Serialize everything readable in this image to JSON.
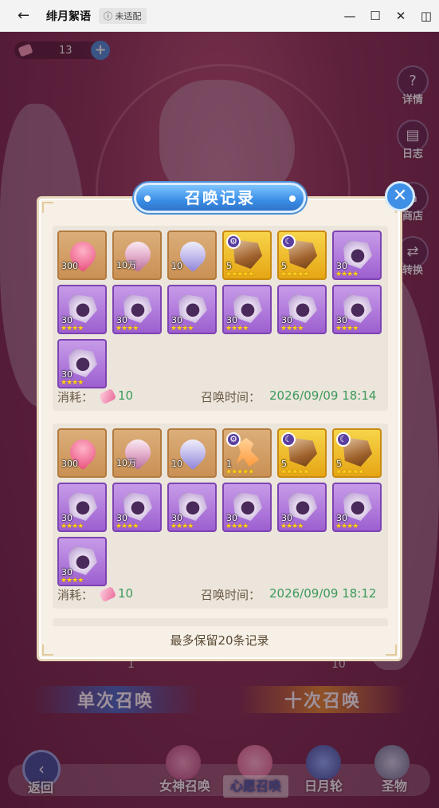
{
  "window": {
    "title": "绯月絮语",
    "badge": "ⓘ 未适配",
    "back_icon": "←",
    "controls": [
      "—",
      "☐",
      "✕",
      "◫"
    ]
  },
  "game": {
    "currency": {
      "value": "13",
      "plus": "+"
    },
    "side_buttons": [
      {
        "label": "详情",
        "icon": "?"
      },
      {
        "label": "日志",
        "icon": "▤"
      },
      {
        "label": "商店",
        "icon": "⌂"
      },
      {
        "label": "转换",
        "icon": "⇄"
      }
    ],
    "summon_single": "单次召唤",
    "summon_ten": "十次召唤",
    "cost_single": "1",
    "cost_ten": "10",
    "bottom_nav": {
      "back_label": "返回",
      "back_icon": "‹",
      "tabs": [
        "女神召唤",
        "心愿召唤",
        "日月轮",
        "圣物"
      ],
      "active_tab": "心愿召唤"
    }
  },
  "modal": {
    "title": "召唤记录",
    "close": "✕",
    "keep_note": "最多保留20条记录",
    "records": [
      {
        "cost_label": "消耗：",
        "cost_value": "10",
        "time_label": "召唤时间：",
        "time_value": "2026/09/09 18:14",
        "items": [
          {
            "kind": "heart",
            "frame": "orange",
            "qty": "300",
            "stars": ""
          },
          {
            "kind": "crystalheart",
            "frame": "orange",
            "qty": "10万",
            "stars": ""
          },
          {
            "kind": "diamond",
            "frame": "orange",
            "qty": "10",
            "stars": ""
          },
          {
            "kind": "shard-brown",
            "frame": "gold",
            "qty": "5",
            "stars": "★★★★★",
            "badge": "⚙"
          },
          {
            "kind": "shard-brown",
            "frame": "gold",
            "qty": "5",
            "stars": "★★★★★",
            "badge": "☾"
          },
          {
            "kind": "shard-purple",
            "frame": "purple",
            "qty": "30",
            "stars": "★★★★"
          },
          {
            "kind": "shard-purple",
            "frame": "purple",
            "qty": "30",
            "stars": "★★★★"
          },
          {
            "kind": "shard-purple",
            "frame": "purple",
            "qty": "30",
            "stars": "★★★★"
          },
          {
            "kind": "shard-purple",
            "frame": "purple",
            "qty": "30",
            "stars": "★★★★"
          },
          {
            "kind": "shard-purple",
            "frame": "purple",
            "qty": "30",
            "stars": "★★★★"
          },
          {
            "kind": "shard-purple",
            "frame": "purple",
            "qty": "30",
            "stars": "★★★★"
          },
          {
            "kind": "shard-purple",
            "frame": "purple",
            "qty": "30",
            "stars": "★★★★"
          },
          {
            "kind": "shard-purple",
            "frame": "purple",
            "qty": "30",
            "stars": "★★★★"
          }
        ]
      },
      {
        "cost_label": "消耗：",
        "cost_value": "10",
        "time_label": "召唤时间：",
        "time_value": "2026/09/09 18:12",
        "items": [
          {
            "kind": "heart",
            "frame": "orange",
            "qty": "300",
            "stars": ""
          },
          {
            "kind": "crystalheart",
            "frame": "orange",
            "qty": "10万",
            "stars": ""
          },
          {
            "kind": "diamond",
            "frame": "orange",
            "qty": "10",
            "stars": ""
          },
          {
            "kind": "spirit",
            "frame": "orange",
            "qty": "1",
            "stars": "★★★★★",
            "badge": "⚙"
          },
          {
            "kind": "shard-brown",
            "frame": "gold",
            "qty": "5",
            "stars": "★★★★★",
            "badge": "☾"
          },
          {
            "kind": "shard-brown",
            "frame": "gold",
            "qty": "5",
            "stars": "★★★★★",
            "badge": "☾"
          },
          {
            "kind": "shard-purple",
            "frame": "purple",
            "qty": "30",
            "stars": "★★★★"
          },
          {
            "kind": "shard-purple",
            "frame": "purple",
            "qty": "30",
            "stars": "★★★★"
          },
          {
            "kind": "shard-purple",
            "frame": "purple",
            "qty": "30",
            "stars": "★★★★"
          },
          {
            "kind": "shard-purple",
            "frame": "purple",
            "qty": "30",
            "stars": "★★★★"
          },
          {
            "kind": "shard-purple",
            "frame": "purple",
            "qty": "30",
            "stars": "★★★★"
          },
          {
            "kind": "shard-purple",
            "frame": "purple",
            "qty": "30",
            "stars": "★★★★"
          },
          {
            "kind": "shard-purple",
            "frame": "purple",
            "qty": "30",
            "stars": "★★★★"
          }
        ]
      }
    ]
  }
}
